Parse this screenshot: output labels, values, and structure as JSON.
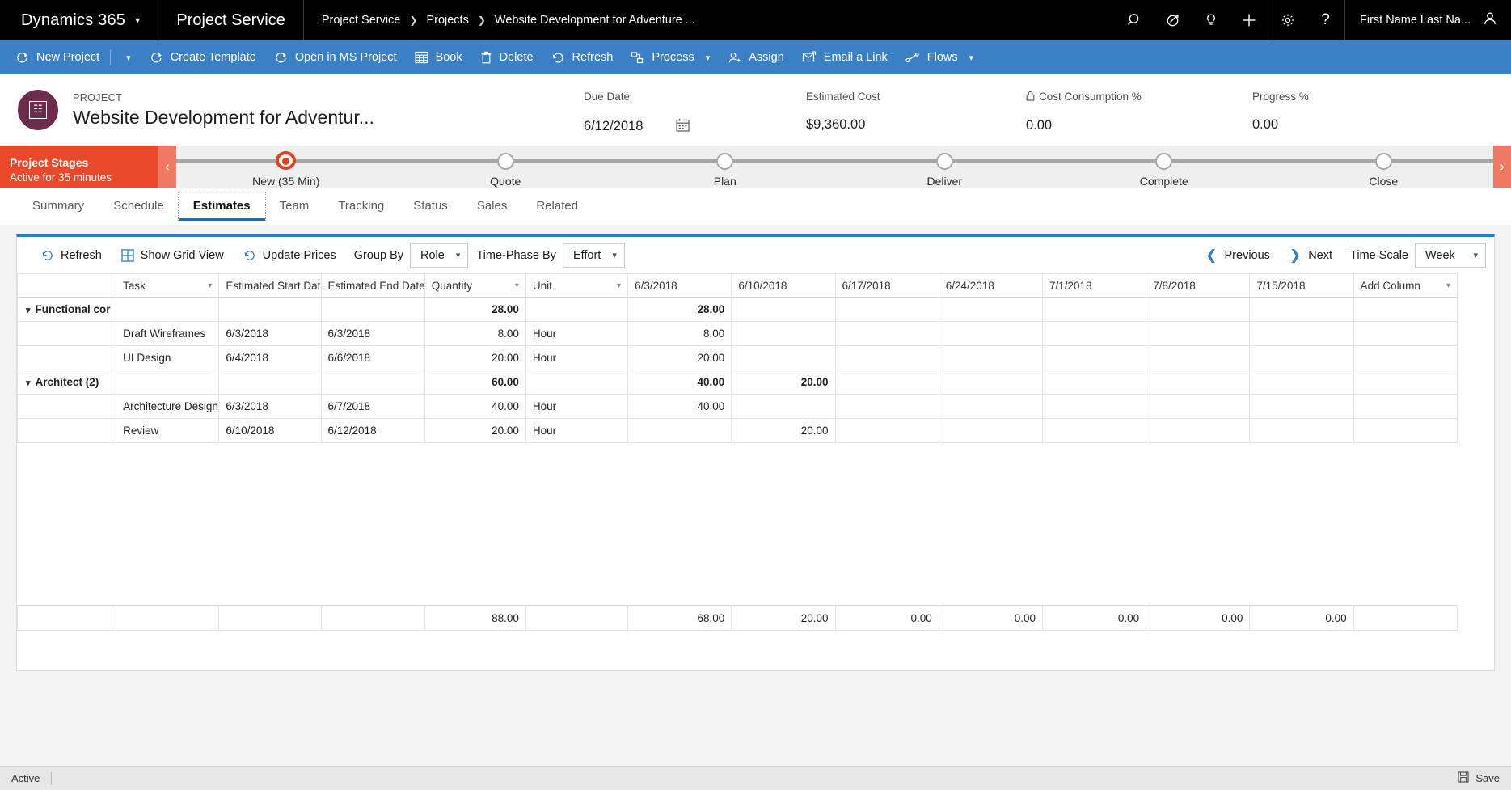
{
  "topnav": {
    "brand": "Dynamics 365",
    "app_name": "Project Service",
    "breadcrumbs": [
      "Project Service",
      "Projects",
      "Website Development for Adventure ..."
    ],
    "separator": "›",
    "icons": [
      "search-icon",
      "assistant-icon",
      "lightbulb-icon",
      "plus-icon",
      "gear-icon",
      "help-icon"
    ],
    "user_name": "First Name Last Na...",
    "help_label": "?"
  },
  "commandbar": {
    "items": [
      {
        "label": "New Project",
        "icon": "refresh-project-icon",
        "has_caret": true
      },
      {
        "label": "Create Template",
        "icon": "refresh-project-icon",
        "has_caret": false
      },
      {
        "label": "Open in MS Project",
        "icon": "refresh-project-icon",
        "has_caret": false
      },
      {
        "label": "Book",
        "icon": "grid-icon",
        "has_caret": false
      },
      {
        "label": "Delete",
        "icon": "trash-icon",
        "has_caret": false
      },
      {
        "label": "Refresh",
        "icon": "refresh-icon",
        "has_caret": false
      },
      {
        "label": "Process",
        "icon": "process-icon",
        "has_caret": true
      },
      {
        "label": "Assign",
        "icon": "assign-person-icon",
        "has_caret": false
      },
      {
        "label": "Email a Link",
        "icon": "email-icon",
        "has_caret": false
      },
      {
        "label": "Flows",
        "icon": "flows-icon",
        "has_caret": true
      }
    ]
  },
  "record_header": {
    "kicker": "PROJECT",
    "title": "Website Development for Adventur...",
    "avatar_glyph": "☷",
    "metrics": [
      {
        "label": "Due Date",
        "value": "6/12/2018",
        "icon": "calendar-icon",
        "locked": false
      },
      {
        "label": "Estimated Cost",
        "value": "$9,360.00",
        "icon": "",
        "locked": false
      },
      {
        "label": "Cost Consumption %",
        "value": "0.00",
        "icon": "lock-icon",
        "locked": true
      },
      {
        "label": "Progress %",
        "value": "0.00",
        "icon": "",
        "locked": false
      }
    ]
  },
  "process_flow": {
    "title": "Project Stages",
    "subtitle": "Active for 35 minutes",
    "prev_glyph": "‹",
    "next_glyph": "›",
    "stages": [
      {
        "label": "New  (35 Min)",
        "active": true
      },
      {
        "label": "Quote",
        "active": false
      },
      {
        "label": "Plan",
        "active": false
      },
      {
        "label": "Deliver",
        "active": false
      },
      {
        "label": "Complete",
        "active": false
      },
      {
        "label": "Close",
        "active": false
      }
    ]
  },
  "tabs": [
    {
      "label": "Summary",
      "selected": false
    },
    {
      "label": "Schedule",
      "selected": false
    },
    {
      "label": "Estimates",
      "selected": true
    },
    {
      "label": "Team",
      "selected": false
    },
    {
      "label": "Tracking",
      "selected": false
    },
    {
      "label": "Status",
      "selected": false
    },
    {
      "label": "Sales",
      "selected": false
    },
    {
      "label": "Related",
      "selected": false
    }
  ],
  "gridbar": {
    "refresh_label": "Refresh",
    "show_grid_label": "Show Grid View",
    "update_prices_label": "Update Prices",
    "group_by_label": "Group By",
    "group_by_value": "Role",
    "time_phase_label": "Time-Phase By",
    "time_phase_value": "Effort",
    "previous_label": "Previous",
    "next_label": "Next",
    "time_scale_label": "Time Scale",
    "time_scale_value": "Week"
  },
  "grid": {
    "columns": [
      {
        "key": "grip",
        "label": "",
        "sortable": false
      },
      {
        "key": "task",
        "label": "Task",
        "sortable": true
      },
      {
        "key": "start",
        "label": "Estimated Start Date",
        "sortable": true
      },
      {
        "key": "end",
        "label": "Estimated End Date",
        "sortable": true
      },
      {
        "key": "qty",
        "label": "Quantity",
        "sortable": true
      },
      {
        "key": "unit",
        "label": "Unit",
        "sortable": true
      },
      {
        "key": "w1",
        "label": "6/3/2018",
        "sortable": false
      },
      {
        "key": "w2",
        "label": "6/10/2018",
        "sortable": false
      },
      {
        "key": "w3",
        "label": "6/17/2018",
        "sortable": false
      },
      {
        "key": "w4",
        "label": "6/24/2018",
        "sortable": false
      },
      {
        "key": "w5",
        "label": "7/1/2018",
        "sortable": false
      },
      {
        "key": "w6",
        "label": "7/8/2018",
        "sortable": false
      },
      {
        "key": "w7",
        "label": "7/15/2018",
        "sortable": false
      },
      {
        "key": "add",
        "label": "Add Column",
        "sortable": true
      }
    ],
    "expand_glyph": "⌄",
    "rows": [
      {
        "type": "group",
        "name": "Functional cor",
        "task": "",
        "start": "",
        "end": "",
        "qty": "28.00",
        "unit": "",
        "w1": "28.00",
        "w2": "",
        "w3": "",
        "w4": "",
        "w5": "",
        "w6": "",
        "w7": "",
        "add": ""
      },
      {
        "type": "task",
        "name": "",
        "task": "Draft Wireframes",
        "start": "6/3/2018",
        "end": "6/3/2018",
        "qty": "8.00",
        "unit": "Hour",
        "w1": "8.00",
        "w2": "",
        "w3": "",
        "w4": "",
        "w5": "",
        "w6": "",
        "w7": "",
        "add": ""
      },
      {
        "type": "task",
        "name": "",
        "task": "UI Design",
        "start": "6/4/2018",
        "end": "6/6/2018",
        "qty": "20.00",
        "unit": "Hour",
        "w1": "20.00",
        "w2": "",
        "w3": "",
        "w4": "",
        "w5": "",
        "w6": "",
        "w7": "",
        "add": ""
      },
      {
        "type": "group",
        "name": "Architect (2)",
        "task": "",
        "start": "",
        "end": "",
        "qty": "60.00",
        "unit": "",
        "w1": "40.00",
        "w2": "20.00",
        "w3": "",
        "w4": "",
        "w5": "",
        "w6": "",
        "w7": "",
        "add": ""
      },
      {
        "type": "task",
        "name": "",
        "task": "Architecture Design",
        "start": "6/3/2018",
        "end": "6/7/2018",
        "qty": "40.00",
        "unit": "Hour",
        "w1": "40.00",
        "w2": "",
        "w3": "",
        "w4": "",
        "w5": "",
        "w6": "",
        "w7": "",
        "add": ""
      },
      {
        "type": "task",
        "name": "",
        "task": "Review",
        "start": "6/10/2018",
        "end": "6/12/2018",
        "qty": "20.00",
        "unit": "Hour",
        "w1": "",
        "w2": "20.00",
        "w3": "",
        "w4": "",
        "w5": "",
        "w6": "",
        "w7": "",
        "add": ""
      }
    ],
    "totals": {
      "name": "",
      "task": "",
      "start": "",
      "end": "",
      "qty": "88.00",
      "unit": "",
      "w1": "68.00",
      "w2": "20.00",
      "w3": "0.00",
      "w4": "0.00",
      "w5": "0.00",
      "w6": "0.00",
      "w7": "0.00",
      "add": ""
    }
  },
  "statusbar": {
    "state": "Active",
    "save_label": "Save",
    "save_icon": "save-disk-icon"
  },
  "colors": {
    "topnav_bg": "#000000",
    "command_bar_bg": "#3b7fc4",
    "process_active": "#d94423",
    "process_banner": "#e8492b",
    "tab_underline": "#2266b0",
    "panel_top_border": "#2b7cc4",
    "avatar_bg": "#6c2c4c",
    "accent_link": "#2b7cc4"
  }
}
